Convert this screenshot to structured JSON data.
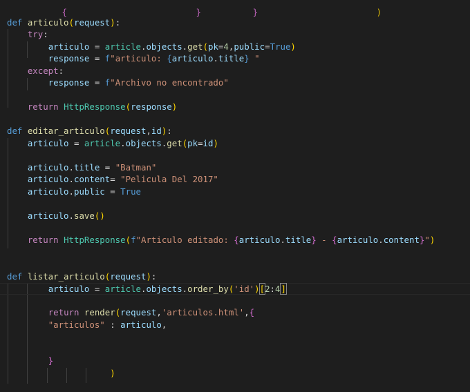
{
  "editor": {
    "colors": {
      "background": "#1e1e1e",
      "keyword": "#569cd6",
      "control": "#c586c0",
      "function": "#dcdcaa",
      "variable": "#9cdcfe",
      "class": "#4ec9b0",
      "string": "#ce9178",
      "number": "#b5cea8"
    },
    "lines": {
      "top_partial": "                {                         }          }                       )",
      "l1": [
        {
          "t": "def ",
          "c": "kw"
        },
        {
          "t": "articulo",
          "c": "fn"
        },
        {
          "t": "(",
          "c": "brk1"
        },
        {
          "t": "request",
          "c": "var"
        },
        {
          "t": ")",
          "c": "brk1"
        },
        {
          "t": ":",
          "c": "p"
        }
      ],
      "l2": [
        {
          "t": "    ",
          "c": "p"
        },
        {
          "t": "try",
          "c": "ctrl"
        },
        {
          "t": ":",
          "c": "p"
        }
      ],
      "l3": [
        {
          "t": "        ",
          "c": "p"
        },
        {
          "t": "articulo",
          "c": "var"
        },
        {
          "t": " = ",
          "c": "p"
        },
        {
          "t": "article",
          "c": "cls"
        },
        {
          "t": ".",
          "c": "p"
        },
        {
          "t": "objects",
          "c": "var"
        },
        {
          "t": ".",
          "c": "p"
        },
        {
          "t": "get",
          "c": "fn"
        },
        {
          "t": "(",
          "c": "brk1"
        },
        {
          "t": "pk",
          "c": "var"
        },
        {
          "t": "=",
          "c": "p"
        },
        {
          "t": "4",
          "c": "num"
        },
        {
          "t": ",",
          "c": "p"
        },
        {
          "t": "public",
          "c": "var"
        },
        {
          "t": "=",
          "c": "p"
        },
        {
          "t": "True",
          "c": "kw"
        },
        {
          "t": ")",
          "c": "brk1"
        }
      ],
      "l4": [
        {
          "t": "        ",
          "c": "p"
        },
        {
          "t": "response",
          "c": "var"
        },
        {
          "t": " = ",
          "c": "p"
        },
        {
          "t": "f",
          "c": "kw"
        },
        {
          "t": "\"articulo: ",
          "c": "str"
        },
        {
          "t": "{",
          "c": "brace"
        },
        {
          "t": "articulo",
          "c": "var"
        },
        {
          "t": ".",
          "c": "p"
        },
        {
          "t": "title",
          "c": "var"
        },
        {
          "t": "}",
          "c": "brace"
        },
        {
          "t": " \"",
          "c": "str"
        }
      ],
      "l5": [
        {
          "t": "    ",
          "c": "p"
        },
        {
          "t": "except",
          "c": "ctrl"
        },
        {
          "t": ":",
          "c": "p"
        }
      ],
      "l6": [
        {
          "t": "        ",
          "c": "p"
        },
        {
          "t": "response",
          "c": "var"
        },
        {
          "t": " = ",
          "c": "p"
        },
        {
          "t": "f",
          "c": "kw"
        },
        {
          "t": "\"Archivo no encontrado\"",
          "c": "str"
        }
      ],
      "l8": [
        {
          "t": "    ",
          "c": "p"
        },
        {
          "t": "return",
          "c": "ctrl"
        },
        {
          "t": " ",
          "c": "p"
        },
        {
          "t": "HttpResponse",
          "c": "cls"
        },
        {
          "t": "(",
          "c": "brk1"
        },
        {
          "t": "response",
          "c": "var"
        },
        {
          "t": ")",
          "c": "brk1"
        }
      ],
      "l10": [
        {
          "t": "def ",
          "c": "kw"
        },
        {
          "t": "editar_articulo",
          "c": "fn"
        },
        {
          "t": "(",
          "c": "brk1"
        },
        {
          "t": "request",
          "c": "var"
        },
        {
          "t": ",",
          "c": "p"
        },
        {
          "t": "id",
          "c": "var"
        },
        {
          "t": ")",
          "c": "brk1"
        },
        {
          "t": ":",
          "c": "p"
        }
      ],
      "l11": [
        {
          "t": "    ",
          "c": "p"
        },
        {
          "t": "articulo",
          "c": "var"
        },
        {
          "t": " = ",
          "c": "p"
        },
        {
          "t": "article",
          "c": "cls"
        },
        {
          "t": ".",
          "c": "p"
        },
        {
          "t": "objects",
          "c": "var"
        },
        {
          "t": ".",
          "c": "p"
        },
        {
          "t": "get",
          "c": "fn"
        },
        {
          "t": "(",
          "c": "brk1"
        },
        {
          "t": "pk",
          "c": "var"
        },
        {
          "t": "=",
          "c": "p"
        },
        {
          "t": "id",
          "c": "var"
        },
        {
          "t": ")",
          "c": "brk1"
        }
      ],
      "l13": [
        {
          "t": "    ",
          "c": "p"
        },
        {
          "t": "articulo",
          "c": "var"
        },
        {
          "t": ".",
          "c": "p"
        },
        {
          "t": "title",
          "c": "var"
        },
        {
          "t": " = ",
          "c": "p"
        },
        {
          "t": "\"Batman\"",
          "c": "str"
        }
      ],
      "l14": [
        {
          "t": "    ",
          "c": "p"
        },
        {
          "t": "articulo",
          "c": "var"
        },
        {
          "t": ".",
          "c": "p"
        },
        {
          "t": "content",
          "c": "var"
        },
        {
          "t": "= ",
          "c": "p"
        },
        {
          "t": "\"Pelicula Del 2017\"",
          "c": "str"
        }
      ],
      "l15": [
        {
          "t": "    ",
          "c": "p"
        },
        {
          "t": "articulo",
          "c": "var"
        },
        {
          "t": ".",
          "c": "p"
        },
        {
          "t": "public",
          "c": "var"
        },
        {
          "t": " = ",
          "c": "p"
        },
        {
          "t": "True",
          "c": "kw"
        }
      ],
      "l17": [
        {
          "t": "    ",
          "c": "p"
        },
        {
          "t": "articulo",
          "c": "var"
        },
        {
          "t": ".",
          "c": "p"
        },
        {
          "t": "save",
          "c": "fn"
        },
        {
          "t": "(",
          "c": "brk1"
        },
        {
          "t": ")",
          "c": "brk1"
        }
      ],
      "l19": [
        {
          "t": "    ",
          "c": "p"
        },
        {
          "t": "return",
          "c": "ctrl"
        },
        {
          "t": " ",
          "c": "p"
        },
        {
          "t": "HttpResponse",
          "c": "cls"
        },
        {
          "t": "(",
          "c": "brk1"
        },
        {
          "t": "f",
          "c": "kw"
        },
        {
          "t": "\"Articulo editado: ",
          "c": "str"
        },
        {
          "t": "{",
          "c": "brk2"
        },
        {
          "t": "articulo",
          "c": "var"
        },
        {
          "t": ".",
          "c": "p"
        },
        {
          "t": "title",
          "c": "var"
        },
        {
          "t": "}",
          "c": "brk2"
        },
        {
          "t": " - ",
          "c": "str"
        },
        {
          "t": "{",
          "c": "brk2"
        },
        {
          "t": "articulo",
          "c": "var"
        },
        {
          "t": ".",
          "c": "p"
        },
        {
          "t": "content",
          "c": "var"
        },
        {
          "t": "}",
          "c": "brk2"
        },
        {
          "t": "\"",
          "c": "str"
        },
        {
          "t": ")",
          "c": "brk1"
        }
      ],
      "l22": [
        {
          "t": "def ",
          "c": "kw"
        },
        {
          "t": "listar_articulo",
          "c": "fn"
        },
        {
          "t": "(",
          "c": "brk1"
        },
        {
          "t": "request",
          "c": "var"
        },
        {
          "t": ")",
          "c": "brk1"
        },
        {
          "t": ":",
          "c": "p"
        }
      ],
      "l23": [
        {
          "t": "        ",
          "c": "p"
        },
        {
          "t": "articulo",
          "c": "var"
        },
        {
          "t": " = ",
          "c": "p"
        },
        {
          "t": "article",
          "c": "cls"
        },
        {
          "t": ".",
          "c": "p"
        },
        {
          "t": "objects",
          "c": "var"
        },
        {
          "t": ".",
          "c": "p"
        },
        {
          "t": "order_by",
          "c": "fn"
        },
        {
          "t": "(",
          "c": "brk1"
        },
        {
          "t": "'id'",
          "c": "str"
        },
        {
          "t": ")",
          "c": "brk1"
        },
        {
          "t": "[",
          "c": "brk1m"
        },
        {
          "t": "2",
          "c": "num"
        },
        {
          "t": ":",
          "c": "p"
        },
        {
          "t": "4",
          "c": "num"
        },
        {
          "t": "]",
          "c": "brk1m"
        }
      ],
      "l25": [
        {
          "t": "        ",
          "c": "p"
        },
        {
          "t": "return",
          "c": "ctrl"
        },
        {
          "t": " ",
          "c": "p"
        },
        {
          "t": "render",
          "c": "fn"
        },
        {
          "t": "(",
          "c": "brk1"
        },
        {
          "t": "request",
          "c": "var"
        },
        {
          "t": ",",
          "c": "p"
        },
        {
          "t": "'articulos.html'",
          "c": "str"
        },
        {
          "t": ",",
          "c": "p"
        },
        {
          "t": "{",
          "c": "brk2"
        }
      ],
      "l26": [
        {
          "t": "        ",
          "c": "p"
        },
        {
          "t": "\"articulos\"",
          "c": "str"
        },
        {
          "t": " : ",
          "c": "p"
        },
        {
          "t": "articulo",
          "c": "var"
        },
        {
          "t": ",",
          "c": "p"
        }
      ],
      "l29": [
        {
          "t": "        ",
          "c": "p"
        },
        {
          "t": "}",
          "c": "brk2"
        }
      ],
      "l30": [
        {
          "t": "                    ",
          "c": "p"
        },
        {
          "t": ")",
          "c": "brk1"
        }
      ]
    }
  }
}
